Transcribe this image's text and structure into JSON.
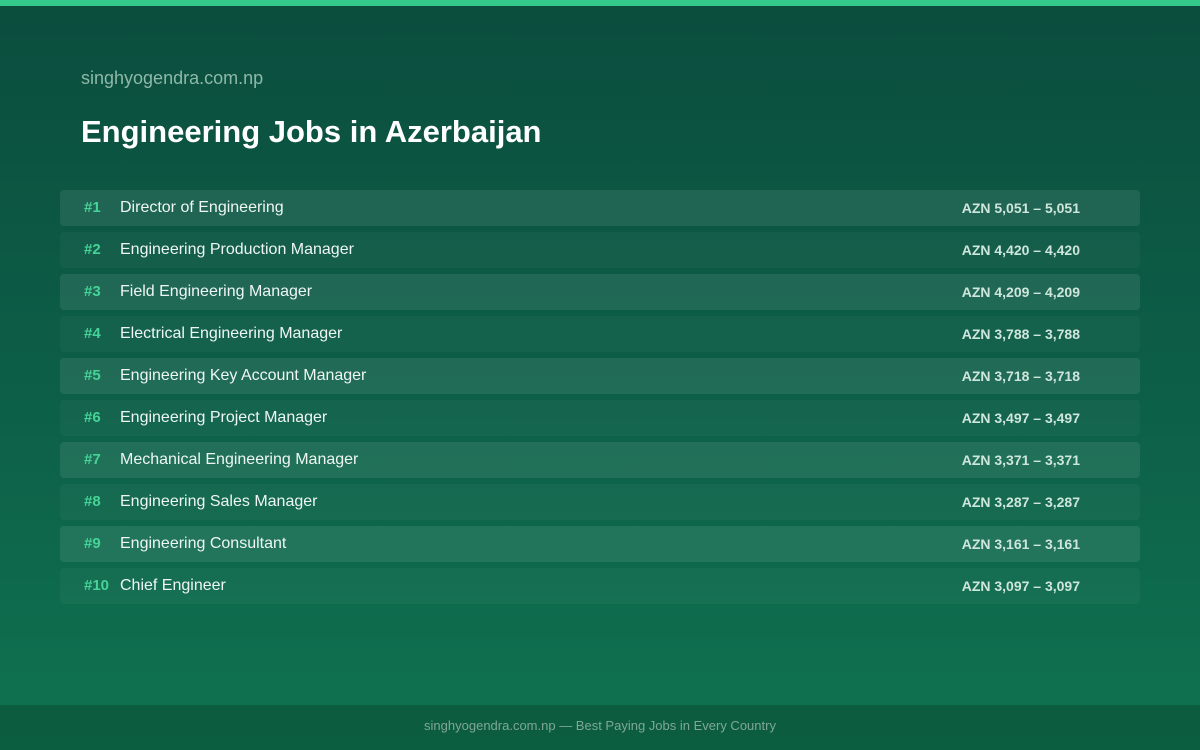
{
  "header": {
    "site": "singhyogendra.com.np",
    "title": "Engineering Jobs in Azerbaijan"
  },
  "colors": {
    "accent": "#34c98a",
    "rank": "#46d398",
    "background_top": "#0b4d3e",
    "background_bottom": "#0f7350"
  },
  "jobs": [
    {
      "rank": "#1",
      "title": "Director of Engineering",
      "salary": "AZN 5,051 – 5,051"
    },
    {
      "rank": "#2",
      "title": "Engineering Production Manager",
      "salary": "AZN 4,420 – 4,420"
    },
    {
      "rank": "#3",
      "title": "Field Engineering Manager",
      "salary": "AZN 4,209 – 4,209"
    },
    {
      "rank": "#4",
      "title": "Electrical Engineering Manager",
      "salary": "AZN 3,788 – 3,788"
    },
    {
      "rank": "#5",
      "title": "Engineering Key Account Manager",
      "salary": "AZN 3,718 – 3,718"
    },
    {
      "rank": "#6",
      "title": "Engineering Project Manager",
      "salary": "AZN 3,497 – 3,497"
    },
    {
      "rank": "#7",
      "title": "Mechanical Engineering Manager",
      "salary": "AZN 3,371 – 3,371"
    },
    {
      "rank": "#8",
      "title": "Engineering Sales Manager",
      "salary": "AZN 3,287 – 3,287"
    },
    {
      "rank": "#9",
      "title": "Engineering Consultant",
      "salary": "AZN 3,161 – 3,161"
    },
    {
      "rank": "#10",
      "title": "Chief Engineer",
      "salary": "AZN 3,097 – 3,097"
    }
  ],
  "footer": {
    "text": "singhyogendra.com.np — Best Paying Jobs in Every Country"
  }
}
